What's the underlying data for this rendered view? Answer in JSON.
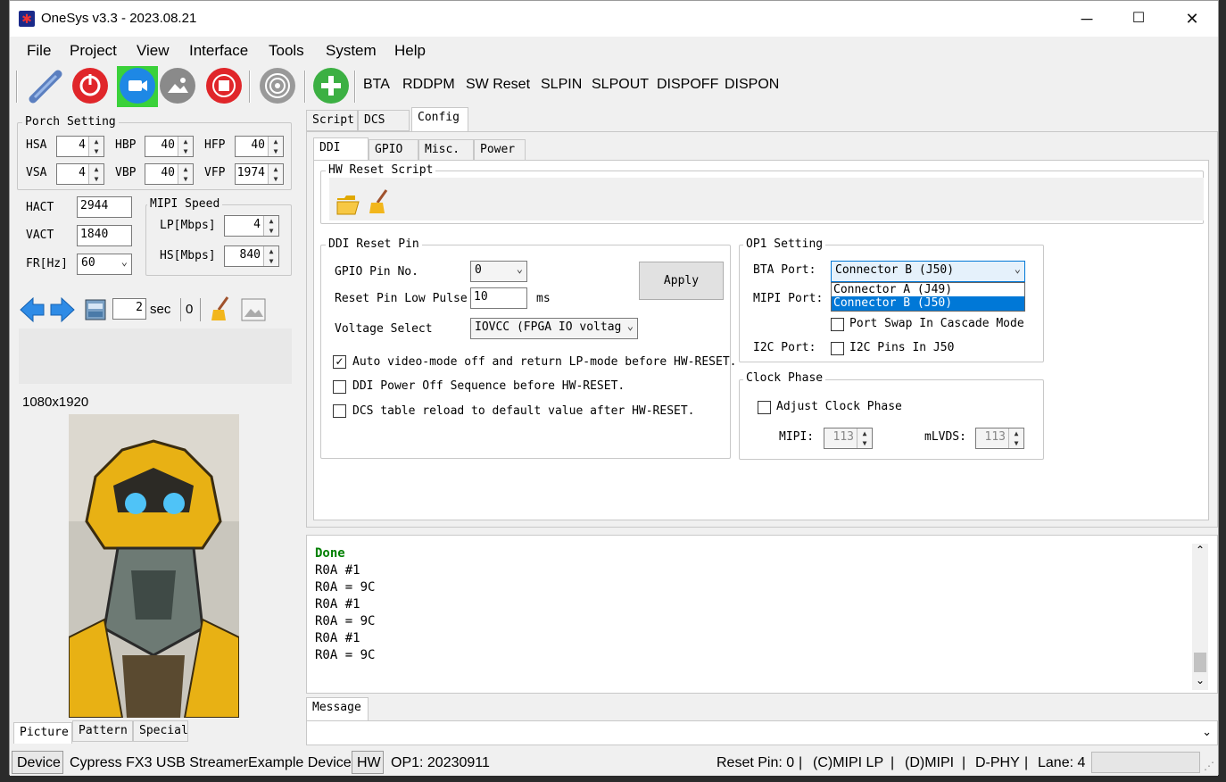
{
  "window": {
    "title": "OneSys v3.3 - 2023.08.21",
    "minimize": "─",
    "maximize": "☐",
    "close": "✕"
  },
  "menu": [
    "File",
    "Project",
    "View",
    "Interface",
    "Tools",
    "System",
    "Help"
  ],
  "toolbar": {
    "icons": [
      "plug-icon",
      "power-icon",
      "camera-icon",
      "image-icon",
      "stop-icon",
      "broadcast-icon",
      "add-icon"
    ],
    "commands": [
      "BTA",
      "RDDPM",
      "SW Reset",
      "SLPIN",
      "SLPOUT",
      "DISPOFF",
      "DISPON"
    ]
  },
  "porch": {
    "label": "Porch Setting",
    "hsa_label": "HSA",
    "hsa": "4",
    "hbp_label": "HBP",
    "hbp": "40",
    "hfp_label": "HFP",
    "hfp": "40",
    "vsa_label": "VSA",
    "vsa": "4",
    "vbp_label": "VBP",
    "vbp": "40",
    "vfp_label": "VFP",
    "vfp": "1974"
  },
  "timing": {
    "hact_label": "HACT",
    "hact": "2944",
    "vact_label": "VACT",
    "vact": "1840",
    "fr_label": "FR[Hz]",
    "fr": "60"
  },
  "mipi_speed": {
    "label": "MIPI Speed",
    "lp_label": "LP[Mbps]",
    "lp": "4",
    "hs_label": "HS[Mbps]",
    "hs": "840"
  },
  "playback": {
    "interval": "2",
    "unit": "sec",
    "counter": "0"
  },
  "preview": {
    "resolution": "1080x1920"
  },
  "left_tabs": [
    "Picture",
    "Pattern",
    "Special"
  ],
  "main_tabs": [
    "Script",
    "DCS",
    "Config"
  ],
  "sub_tabs": [
    "DDI",
    "GPIO",
    "Misc.",
    "Power"
  ],
  "hw_reset": {
    "label": "HW Reset Script"
  },
  "ddi_reset": {
    "label": "DDI Reset Pin",
    "gpio_label": "GPIO Pin No.",
    "gpio": "0",
    "pulse_label": "Reset Pin Low Pulse",
    "pulse": "10",
    "pulse_unit": "ms",
    "voltage_label": "Voltage Select",
    "voltage": "IOVCC (FPGA IO voltag",
    "apply": "Apply",
    "opt1": "Auto video-mode off and return LP-mode before HW-RESET.",
    "opt2": "DDI Power Off Sequence before HW-RESET.",
    "opt3": "DCS table reload to default value after HW-RESET."
  },
  "op1": {
    "label": "OP1 Setting",
    "bta_label": "BTA Port:",
    "bta": "Connector B (J50)",
    "options": [
      "Connector A (J49)",
      "Connector B (J50)"
    ],
    "mipi_label": "MIPI Port:",
    "swap": "Port Swap In Cascade Mode",
    "i2c_label": "I2C Port:",
    "i2c": "I2C Pins In J50"
  },
  "clock": {
    "label": "Clock Phase",
    "adjust": "Adjust Clock Phase",
    "mipi_label": "MIPI:",
    "mipi": "113",
    "mlvds_label": "mLVDS:",
    "mlvds": "113"
  },
  "log": [
    "Done",
    "R0A #1",
    "R0A = 9C",
    "R0A #1",
    "R0A = 9C",
    "R0A #1",
    "R0A = 9C"
  ],
  "message_tab": "Message",
  "status": {
    "device": "Device",
    "device_name": "Cypress FX3 USB StreamerExample Device",
    "hw": "HW",
    "op1": "OP1: 20230911",
    "reset": "Reset Pin: 0",
    "c": "(C)MIPI  LP",
    "d": "(D)MIPI",
    "phy": "D-PHY",
    "lane": "Lane: 4"
  },
  "colors": {
    "accent_blue": "#0078d7",
    "done_green": "#008000",
    "highlight": "#3399ff"
  }
}
